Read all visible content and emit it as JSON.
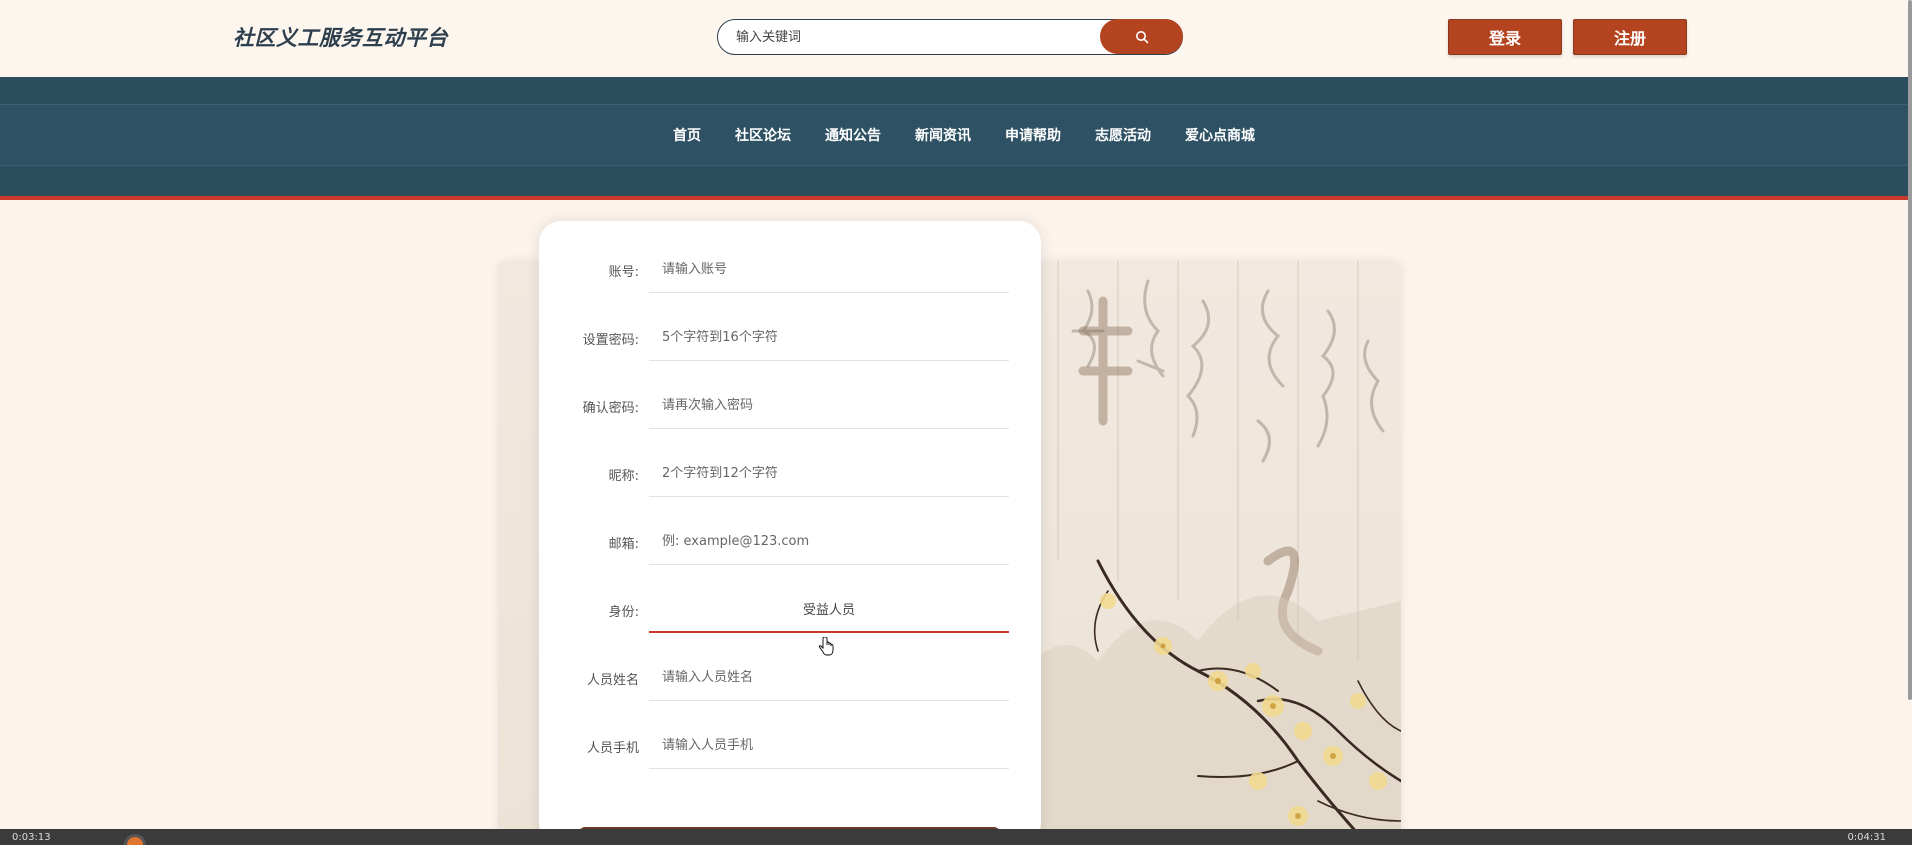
{
  "header": {
    "brand": "社区义工服务互动平台",
    "search_placeholder": "输入关键词",
    "login_label": "登录",
    "register_label": "注册"
  },
  "nav": {
    "items": [
      "首页",
      "社区论坛",
      "通知公告",
      "新闻资讯",
      "申请帮助",
      "志愿活动",
      "爱心点商城"
    ]
  },
  "form": {
    "fields": [
      {
        "label": "账号:",
        "placeholder": "请输入账号"
      },
      {
        "label": "设置密码:",
        "placeholder": "5个字符到16个字符"
      },
      {
        "label": "确认密码:",
        "placeholder": "请再次输入密码"
      },
      {
        "label": "昵称:",
        "placeholder": "2个字符到12个字符"
      },
      {
        "label": "邮箱:",
        "placeholder": "例: example@123.com"
      },
      {
        "label": "身份:",
        "value": "受益人员"
      },
      {
        "label": "人员姓名",
        "placeholder": "请输入人员姓名"
      },
      {
        "label": "人员手机",
        "placeholder": "请输入人员手机"
      }
    ]
  },
  "videobar": {
    "time_left": "0:03:13",
    "time_right": "0:04:31"
  },
  "colors": {
    "accent": "#b4431f",
    "nav_bg": "#2c4d5e",
    "nav_border": "#c8382b",
    "page_bg": "#fbf3ec"
  }
}
